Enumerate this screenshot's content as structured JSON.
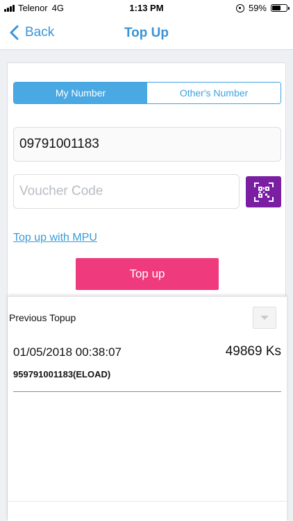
{
  "status_bar": {
    "carrier": "Telenor",
    "network": "4G",
    "time": "1:13 PM",
    "battery": "59%",
    "battery_level": 0.59
  },
  "nav": {
    "back_label": "Back",
    "title": "Top Up"
  },
  "tabs": {
    "my_number": "My Number",
    "others_number": "Other's Number",
    "active": "my_number"
  },
  "form": {
    "phone_value": "09791001183",
    "voucher_placeholder": "Voucher Code",
    "mpu_link": "Top up with MPU",
    "topup_button": "Top up"
  },
  "previous_topup": {
    "title": "Previous Topup",
    "items": [
      {
        "datetime": "01/05/2018 00:38:07",
        "amount": "49869 Ks",
        "number": "959791001183(ELOAD)"
      }
    ]
  },
  "colors": {
    "accent_blue": "#3a93d8",
    "tab_active": "#4aa8e3",
    "qr_purple": "#7a1fa2",
    "topup_pink": "#ef3b7d"
  },
  "icons": {
    "back": "chevron-left-icon",
    "qr": "qr-scan-icon",
    "dropdown": "caret-down-icon"
  }
}
